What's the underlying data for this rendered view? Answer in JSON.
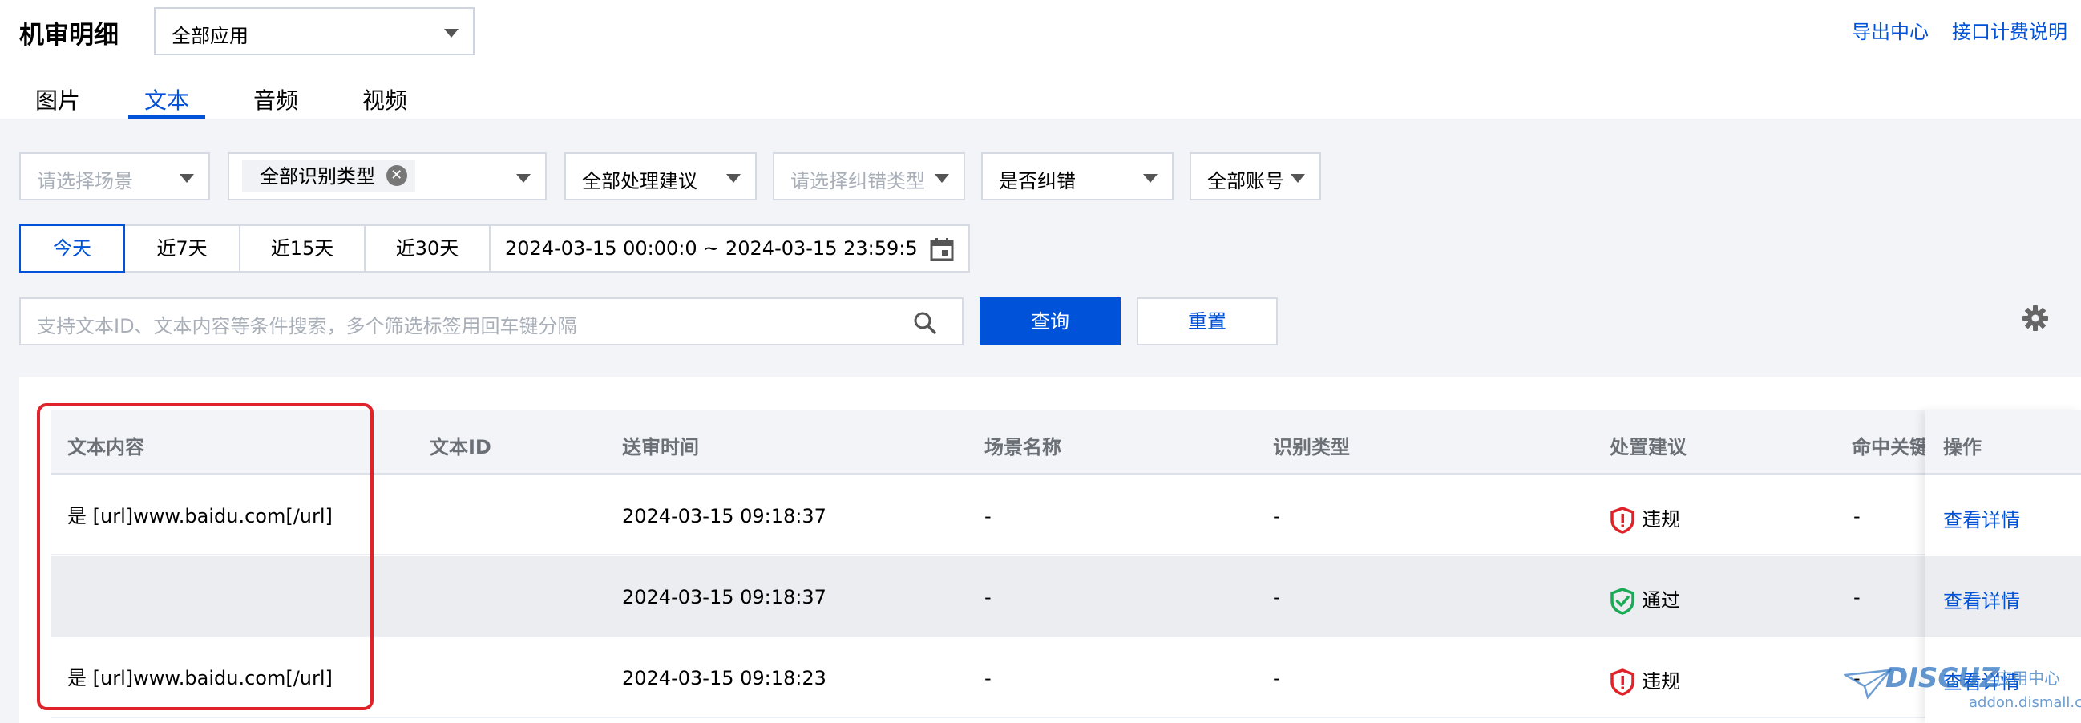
{
  "header": {
    "title": "机审明细",
    "app_select": "全部应用",
    "links": [
      "导出中心",
      "接口计费说明"
    ]
  },
  "tabs": [
    {
      "label": "图片",
      "active": false
    },
    {
      "label": "文本",
      "active": true
    },
    {
      "label": "音频",
      "active": false
    },
    {
      "label": "视频",
      "active": false
    }
  ],
  "filters": {
    "scene_placeholder": "请选择场景",
    "recognition_type_chip": "全部识别类型",
    "suggestion": "全部处理建议",
    "correction_type_placeholder": "请选择纠错类型",
    "is_corrected": "是否纠错",
    "account": "全部账号"
  },
  "date_range": {
    "quick_ranges": [
      "今天",
      "近7天",
      "近15天",
      "近30天"
    ],
    "selected": "今天",
    "value": "2024-03-15 00:00:0 ~ 2024-03-15 23:59:5"
  },
  "search": {
    "placeholder": "支持文本ID、文本内容等条件搜索，多个筛选标签用回车键分隔",
    "query_button": "查询",
    "reset_button": "重置"
  },
  "table": {
    "columns": [
      "文本内容",
      "文本ID",
      "送审时间",
      "场景名称",
      "识别类型",
      "处置建议",
      "命中关键",
      "操作"
    ],
    "rows": [
      {
        "content": "是 [url]www.baidu.com[/url]",
        "text_id": "",
        "time": "2024-03-15 09:18:37",
        "scene": "-",
        "type": "-",
        "suggestion": "违规",
        "keyword": "-",
        "action": "查看详情"
      },
      {
        "content": "",
        "text_id": "",
        "time": "2024-03-15 09:18:37",
        "scene": "-",
        "type": "-",
        "suggestion": "通过",
        "keyword": "-",
        "action": "查看详情"
      },
      {
        "content": "是 [url]www.baidu.com[/url]",
        "text_id": "",
        "time": "2024-03-15 09:18:23",
        "scene": "-",
        "type": "-",
        "suggestion": "违规",
        "keyword": "-",
        "action": "查看详情"
      }
    ]
  },
  "colors": {
    "primary": "#0052d9",
    "violation": "#e0232a",
    "pass": "#1aaa55",
    "highlight_box": "#e0232a"
  },
  "watermark": {
    "logo": "DISCUZ",
    "subtitle": "应用中心",
    "url": "addon.dismall.com"
  }
}
